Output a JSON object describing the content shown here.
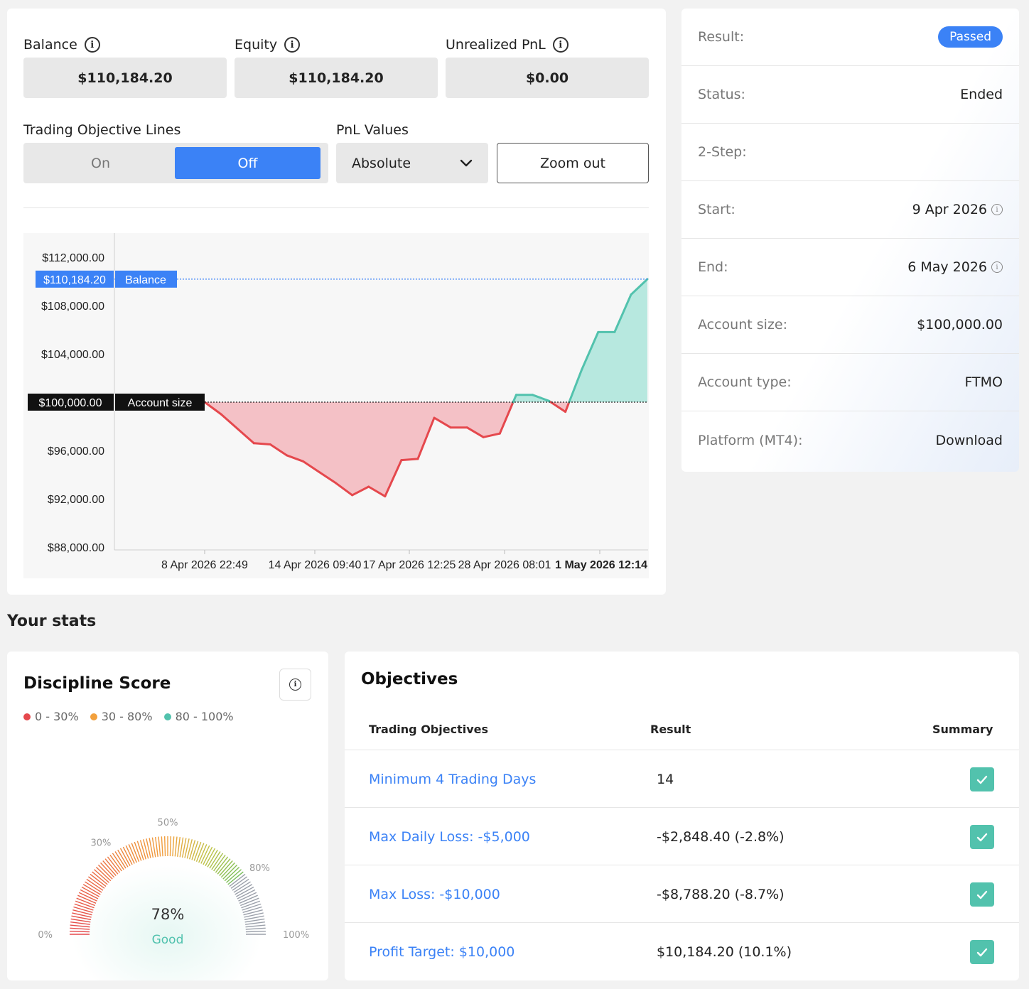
{
  "metrics": {
    "balance": {
      "label": "Balance",
      "value": "$110,184.20"
    },
    "equity": {
      "label": "Equity",
      "value": "$110,184.20"
    },
    "unrealized": {
      "label": "Unrealized PnL",
      "value": "$0.00"
    }
  },
  "controls": {
    "objective_lines_label": "Trading Objective Lines",
    "toggle_on": "On",
    "toggle_off": "Off",
    "toggle_selected": "Off",
    "pnl_label": "PnL Values",
    "pnl_selected": "Absolute",
    "zoom_out": "Zoom out"
  },
  "chart_data": {
    "type": "line",
    "y_ticks": [
      "$112,000.00",
      "$108,000.00",
      "$104,000.00",
      "$96,000.00",
      "$92,000.00",
      "$88,000.00"
    ],
    "y_tick_values": [
      112000,
      108000,
      104000,
      96000,
      92000,
      88000
    ],
    "ylim": [
      88000,
      112000
    ],
    "x_ticks": [
      "8 Apr 2026 22:49",
      "14 Apr 2026 09:40",
      "17 Apr 2026 12:25",
      "28 Apr 2026 08:01",
      "1 May 2026 12:14"
    ],
    "balance_marker": {
      "value_label": "$110,184.20",
      "name": "Balance",
      "value": 110184.2
    },
    "account_size_marker": {
      "value_label": "$100,000.00",
      "name": "Account size",
      "value": 100000
    },
    "series": [
      {
        "values": [
          100000,
          99000,
          97800,
          96600,
          96500,
          95600,
          95100,
          94200,
          93300,
          92300,
          93000,
          92200,
          95200,
          95300,
          98700,
          97900,
          97900,
          97100,
          97400,
          100600,
          100600,
          100100,
          99200,
          102700,
          105800,
          105800,
          108900,
          110184.2
        ]
      }
    ],
    "grid": false
  },
  "info": {
    "rows": [
      {
        "key": "Result:",
        "value": "Passed",
        "badge": true
      },
      {
        "key": "Status:",
        "value": "Ended"
      },
      {
        "key": "2-Step:",
        "value": ""
      },
      {
        "key": "Start:",
        "value": "9 Apr 2026",
        "info": true
      },
      {
        "key": "End:",
        "value": "6 May 2026",
        "info": true
      },
      {
        "key": "Account size:",
        "value": "$100,000.00"
      },
      {
        "key": "Account type:",
        "value": "FTMO"
      },
      {
        "key": "Platform (MT4):",
        "value": "Download"
      }
    ]
  },
  "stats_title": "Your stats",
  "discipline": {
    "title": "Discipline Score",
    "legend": [
      {
        "label": "0 - 30%",
        "color": "#e5484d"
      },
      {
        "label": "30 - 80%",
        "color": "#f2a03d"
      },
      {
        "label": "80 - 100%",
        "color": "#52c2ad"
      }
    ],
    "gauge_labels": {
      "p0": "0%",
      "p30": "30%",
      "p50": "50%",
      "p80": "80%",
      "p100": "100%"
    },
    "score": 0.78,
    "score_text": "78%",
    "rating": "Good"
  },
  "objectives": {
    "title": "Objectives",
    "headers": {
      "name": "Trading Objectives",
      "result": "Result",
      "summary": "Summary"
    },
    "rows": [
      {
        "name": "Minimum 4 Trading Days",
        "result": "14"
      },
      {
        "name": "Max Daily Loss: -$5,000",
        "result": "-$2,848.40 (-2.8%)"
      },
      {
        "name": "Max Loss: -$10,000",
        "result": "-$8,788.20 (-8.7%)"
      },
      {
        "name": "Profit Target: $10,000",
        "result": "$10,184.20 (10.1%)"
      }
    ]
  }
}
